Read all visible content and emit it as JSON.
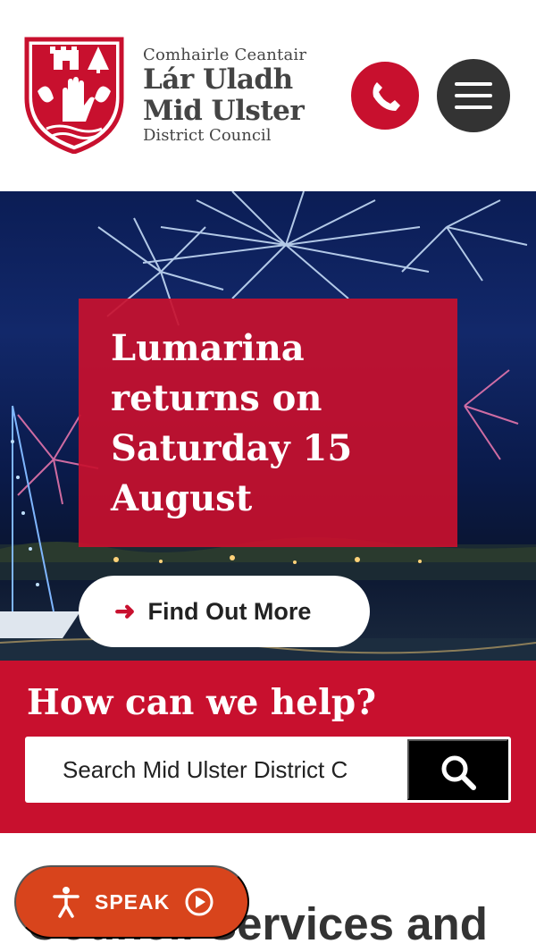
{
  "header": {
    "logo": {
      "irish_line": "Comhairle Ceantair",
      "name_irish": "Lár Uladh",
      "name_english": "Mid Ulster",
      "sub_line": "District Council"
    },
    "phone_icon": "phone-icon",
    "menu_icon": "hamburger-menu-icon"
  },
  "hero": {
    "title": "Lumarina returns on Saturday 15 August",
    "cta_label": "Find Out More",
    "cta_icon": "arrow-right-icon"
  },
  "help": {
    "title": "How can we help?",
    "search_placeholder": "Search Mid Ulster District C",
    "search_icon": "search-icon"
  },
  "lower": {
    "heading": "Council Services and"
  },
  "speak_button": {
    "label": "SPEAK",
    "icons": [
      "accessibility-person-icon",
      "play-icon"
    ]
  },
  "colors": {
    "brand_red": "#c8102e",
    "dark_grey": "#333333",
    "speak_orange": "#d8441c"
  }
}
